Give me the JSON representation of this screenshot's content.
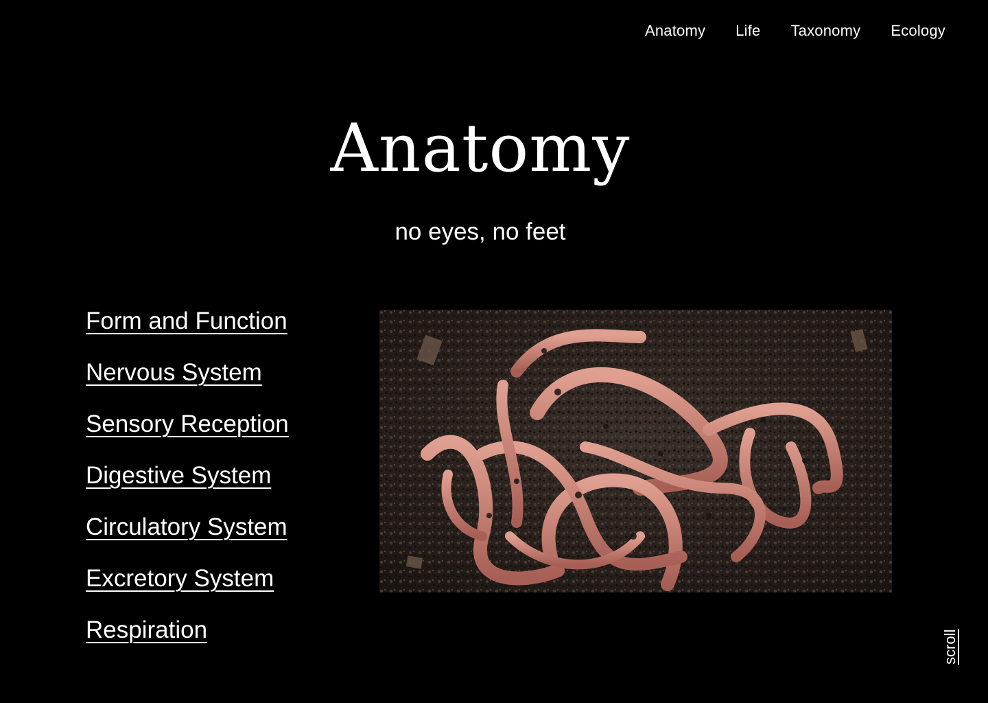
{
  "nav": {
    "items": [
      {
        "label": "Anatomy"
      },
      {
        "label": "Life"
      },
      {
        "label": "Taxonomy"
      },
      {
        "label": "Ecology"
      }
    ]
  },
  "hero": {
    "title": "Anatomy",
    "subtitle": "no eyes, no feet"
  },
  "toc": {
    "items": [
      {
        "label": "Form and Function"
      },
      {
        "label": "Nervous System"
      },
      {
        "label": "Sensory Reception"
      },
      {
        "label": "Digestive System"
      },
      {
        "label": "Circulatory System"
      },
      {
        "label": "Excretory System"
      },
      {
        "label": "Respiration"
      }
    ]
  },
  "photo": {
    "subject": "earthworms-on-soil"
  },
  "scroll": {
    "label": "scroll"
  },
  "colors": {
    "background": "#000000",
    "text": "#ffffff",
    "soil": "#2a211d",
    "worm": "#c98377"
  }
}
